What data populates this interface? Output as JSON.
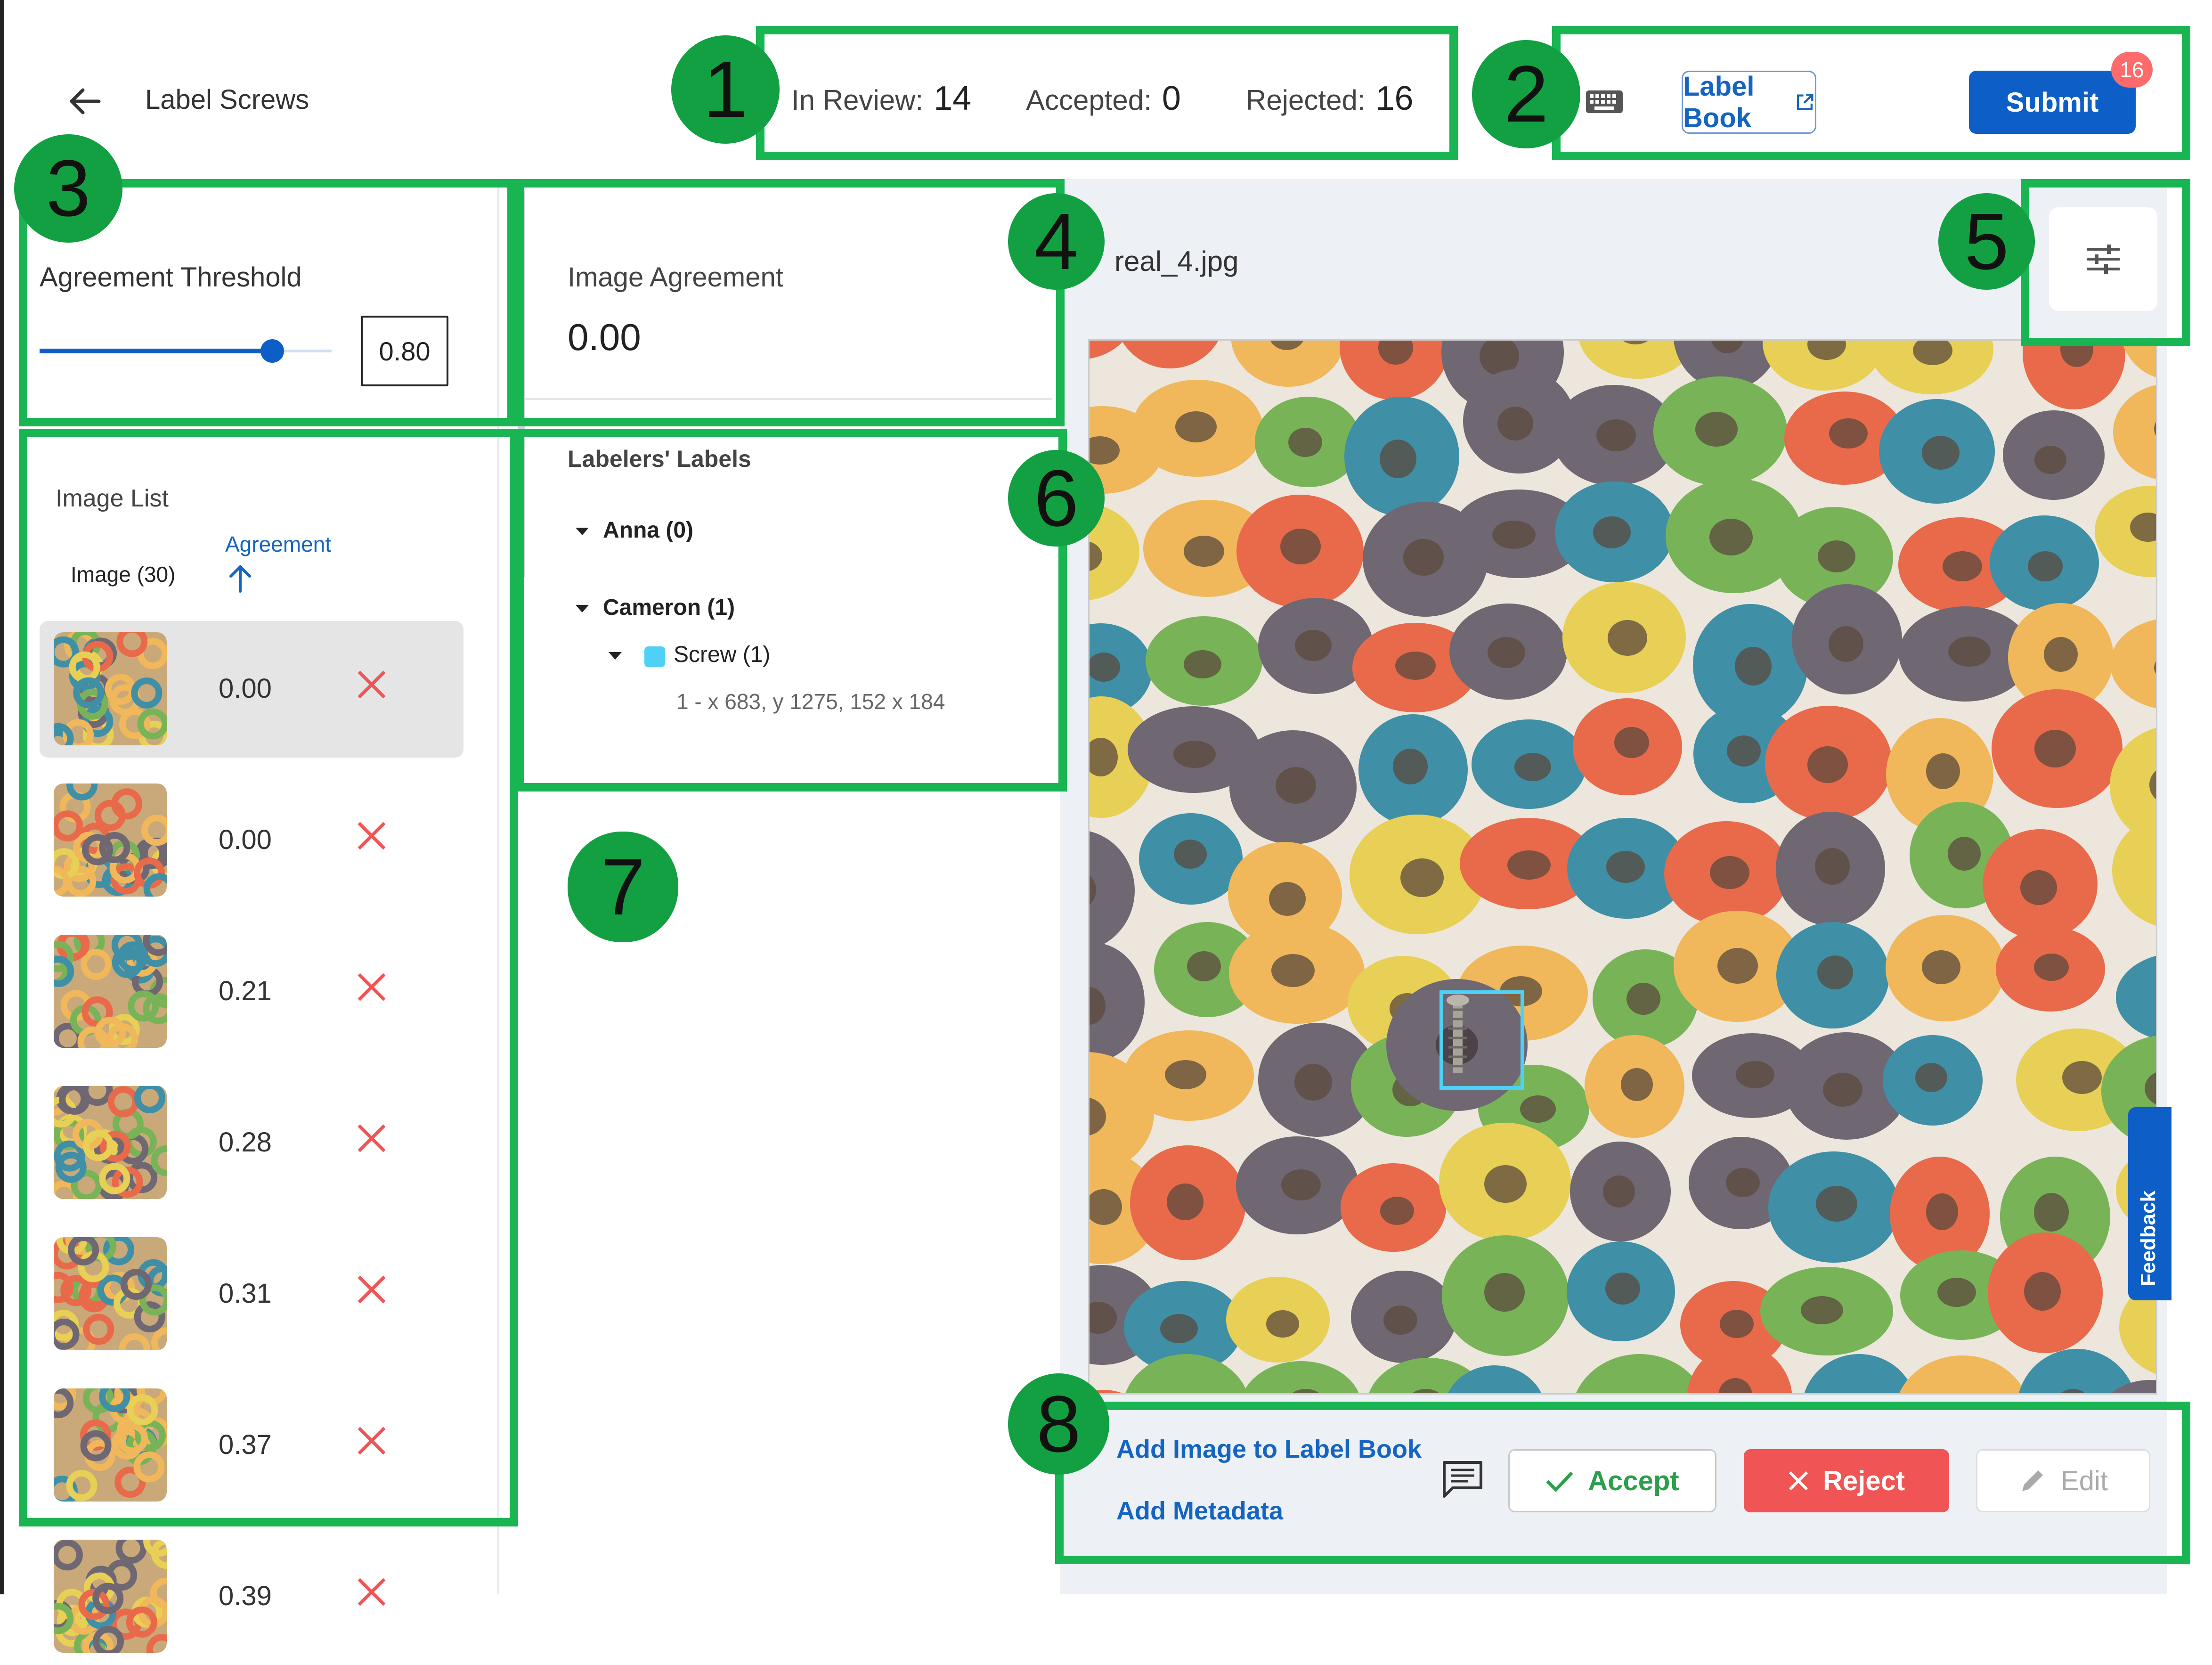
{
  "header": {
    "title": "Label Screws",
    "in_review_label": "In Review:",
    "in_review_count": "14",
    "accepted_label": "Accepted:",
    "accepted_count": "0",
    "rejected_label": "Rejected:",
    "rejected_count": "16",
    "label_book_label": "Label Book",
    "submit_label": "Submit",
    "submit_badge": "16"
  },
  "threshold": {
    "label": "Agreement Threshold",
    "value": "0.80",
    "slider_fraction": 0.8
  },
  "image_list": {
    "label": "Image List",
    "col_image": "Image (30)",
    "col_agreement": "Agreement",
    "sort": "ascending",
    "rows": [
      {
        "value": "0.00",
        "selected": true
      },
      {
        "value": "0.00",
        "selected": false
      },
      {
        "value": "0.21",
        "selected": false
      },
      {
        "value": "0.28",
        "selected": false
      },
      {
        "value": "0.31",
        "selected": false
      },
      {
        "value": "0.37",
        "selected": false
      },
      {
        "value": "0.39",
        "selected": false
      }
    ]
  },
  "image_agreement": {
    "label": "Image Agreement",
    "value": "0.00"
  },
  "labelers": {
    "label": "Labelers' Labels",
    "anna": "Anna (0)",
    "cameron": "Cameron (1)",
    "screw": "Screw (1)",
    "coords": "1 - x 683, y 1275, 152 x 184"
  },
  "viewer": {
    "filename": "real_4.jpg",
    "feedback_label": "Feedback"
  },
  "actions": {
    "add_to_label_book": "Add Image to Label Book",
    "add_metadata": "Add Metadata",
    "accept": "Accept",
    "reject": "Reject",
    "edit": "Edit"
  },
  "annotations": [
    "1",
    "2",
    "3",
    "4",
    "5",
    "6",
    "7",
    "8"
  ],
  "colors": {
    "primary": "#0d5fc7",
    "reject": "#f05454",
    "accept_text": "#2e9e4e",
    "annotation_green": "#1ab553",
    "annotation_circle": "#13a043",
    "label_swatch": "#4fd1f5",
    "cereal_colors": [
      "#e8cf55",
      "#e86a4a",
      "#3f8fa6",
      "#6f6873",
      "#78b457",
      "#f0b85a"
    ]
  }
}
